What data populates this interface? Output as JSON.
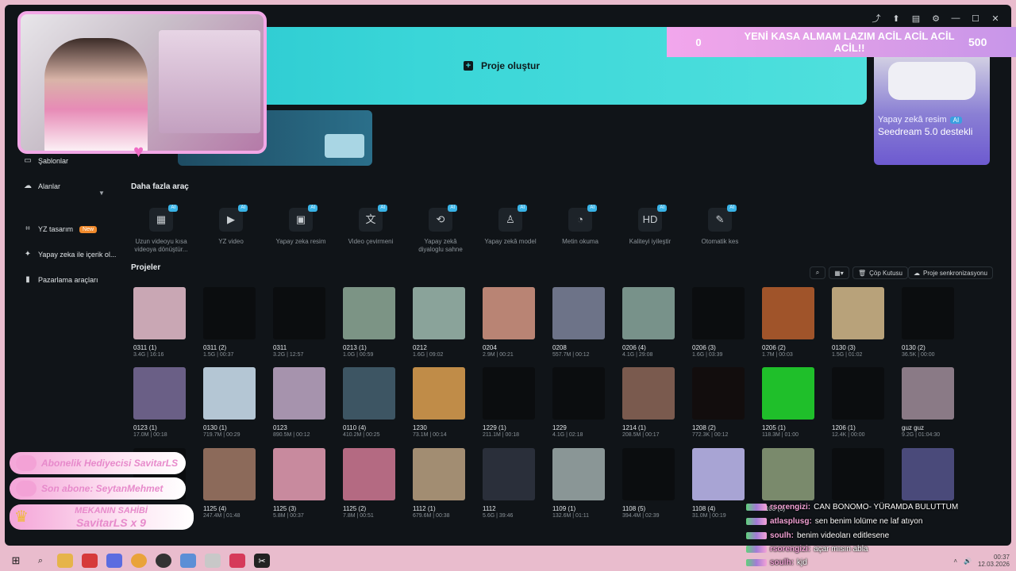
{
  "banner": {
    "create_label": "Proje oluştur"
  },
  "goal_bar": {
    "start": "0",
    "text": "YENİ KASA ALMAM LAZIM ACİL ACİL ACİL ACİL!!",
    "target": "500"
  },
  "ai_card": {
    "title": "Yapay zekâ resim",
    "badge": "AI",
    "subtitle": "Seedream 5.0 destekli"
  },
  "sidebar": [
    {
      "label": "Şablonlar",
      "icon": "template-icon"
    },
    {
      "label": "Alanlar",
      "icon": "cloud-icon"
    },
    {
      "label": "YZ tasarım",
      "icon": "ai-design-icon",
      "badge": "New"
    },
    {
      "label": "Yapay zeka ile içerik ol...",
      "icon": "sparkle-icon"
    },
    {
      "label": "Pazarlama araçları",
      "icon": "marketing-icon"
    }
  ],
  "tools_title": "Daha fazla araç",
  "tools": [
    {
      "l1": "Uzun videoyu kısa",
      "l2": "videoya dönüştür...",
      "icon": "▦"
    },
    {
      "l1": "YZ video",
      "l2": "",
      "icon": "▶"
    },
    {
      "l1": "Yapay zeka resim",
      "l2": "",
      "icon": "▣"
    },
    {
      "l1": "Video çevirmeni",
      "l2": "",
      "icon": "文"
    },
    {
      "l1": "Yapay zekâ",
      "l2": "diyaloglu sahne",
      "icon": "⟲"
    },
    {
      "l1": "Yapay zekâ model",
      "l2": "",
      "icon": "♙"
    },
    {
      "l1": "Metin okuma",
      "l2": "",
      "icon": "◔"
    },
    {
      "l1": "Kaliteyi iyileştir",
      "l2": "",
      "icon": "HD"
    },
    {
      "l1": "Otomatik kes",
      "l2": "",
      "icon": "✎"
    }
  ],
  "tool_badge": "AI",
  "projects_title": "Projeler",
  "toolbar": {
    "trash": "Çöp Kutusu",
    "sync": "Proje senkronizasyonu"
  },
  "projects": [
    [
      {
        "name": "0311 (1)",
        "meta": "3.4G | 16:16",
        "c": "#c9a7b4"
      },
      {
        "name": "0311 (2)",
        "meta": "1.5G | 00:37",
        "c": "#0b0d0f"
      },
      {
        "name": "0311",
        "meta": "3.2G | 12:57",
        "c": "#0b0d0f"
      },
      {
        "name": "0213 (1)",
        "meta": "1.0G | 00:59",
        "c": "#7c9485"
      },
      {
        "name": "0212",
        "meta": "1.6G | 09:02",
        "c": "#8aa39a"
      },
      {
        "name": "0204",
        "meta": "2.9M | 00:21",
        "c": "#b98474"
      },
      {
        "name": "0208",
        "meta": "557.7M | 00:12",
        "c": "#6d7388"
      },
      {
        "name": "0206 (4)",
        "meta": "4.1G | 29:08",
        "c": "#78928a"
      },
      {
        "name": "0206 (3)",
        "meta": "1.6G | 03:39",
        "c": "#0b0d0f"
      },
      {
        "name": "0206 (2)",
        "meta": "1.7M | 00:03",
        "c": "#a0542a"
      },
      {
        "name": "0130 (3)",
        "meta": "1.5G | 01:02",
        "c": "#b8a27a"
      },
      {
        "name": "0130 (2)",
        "meta": "36.5K | 00:00",
        "c": "#0b0d0f"
      }
    ],
    [
      {
        "name": "0123 (1)",
        "meta": "17.0M | 00:18",
        "c": "#6a5f86"
      },
      {
        "name": "0130 (1)",
        "meta": "719.7M | 00:29",
        "c": "#b4c6d4"
      },
      {
        "name": "0123",
        "meta": "890.5M | 00:12",
        "c": "#a693ad"
      },
      {
        "name": "0110 (4)",
        "meta": "410.2M | 00:25",
        "c": "#3d5563"
      },
      {
        "name": "1230",
        "meta": "73.1M | 00:14",
        "c": "#c08c48"
      },
      {
        "name": "1229 (1)",
        "meta": "211.1M | 00:18",
        "c": "#0b0d0f"
      },
      {
        "name": "1229",
        "meta": "4.1G | 02:18",
        "c": "#0b0d0f"
      },
      {
        "name": "1214 (1)",
        "meta": "208.5M | 00:17",
        "c": "#7a5a4e"
      },
      {
        "name": "1208 (2)",
        "meta": "772.3K | 00:12",
        "c": "#120d0d"
      },
      {
        "name": "1205 (1)",
        "meta": "118.3M | 01:00",
        "c": "#1fbf2a"
      },
      {
        "name": "1206 (1)",
        "meta": "12.4K | 00:00",
        "c": "#0b0d0f"
      },
      {
        "name": "guz guz",
        "meta": "9.2G | 01:04:30",
        "c": "#8a7a86"
      }
    ],
    [
      {
        "name": "",
        "meta": "",
        "c": "#0b0d0f"
      },
      {
        "name": "1125 (4)",
        "meta": "247.4M | 01:48",
        "c": "#8c6a5a"
      },
      {
        "name": "1125 (3)",
        "meta": "5.8M | 00:37",
        "c": "#c88a9e"
      },
      {
        "name": "1125 (2)",
        "meta": "7.8M | 00:51",
        "c": "#b46a82"
      },
      {
        "name": "1112 (1)",
        "meta": "679.6M | 00:38",
        "c": "#a28d72"
      },
      {
        "name": "1112",
        "meta": "5.6G | 39:46",
        "c": "#2a2f3a"
      },
      {
        "name": "1109 (1)",
        "meta": "132.6M | 01:11",
        "c": "#8a9696"
      },
      {
        "name": "1108 (5)",
        "meta": "394.4M | 02:39",
        "c": "#0b0d0f"
      },
      {
        "name": "1108 (4)",
        "meta": "31.0M | 00:19",
        "c": "#a8a4d4"
      },
      {
        "name": "1108 (3)",
        "meta": "",
        "c": "#7a8a6c"
      },
      {
        "name": "",
        "meta": "",
        "c": "#0b0d0f"
      },
      {
        "name": "",
        "meta": "",
        "c": "#4a4a7a"
      }
    ]
  ],
  "alerts": {
    "gift": "Abonelik Hediyecisi SavitarLS",
    "sub": "Son abone: SeytanMehmet",
    "crown_l1": "MEKANIN SAHİBİ",
    "crown_l2": "SavitarLS x 9"
  },
  "chat": [
    {
      "user": "rsorengizi:",
      "msg": "CAN BONOMO- YÜRAMDA BULUTTUM"
    },
    {
      "user": "atlasplusg:",
      "msg": "sen benim lolüme ne laf atıyon"
    },
    {
      "user": "soulh:",
      "msg": "benim videoları editlesene"
    },
    {
      "user": "rsorengizi:",
      "msg": "açar mısın abla"
    },
    {
      "user": "soulh:",
      "msg": "kjd"
    }
  ],
  "taskbar": {
    "time": "00:37",
    "date": "12.03.2026"
  }
}
